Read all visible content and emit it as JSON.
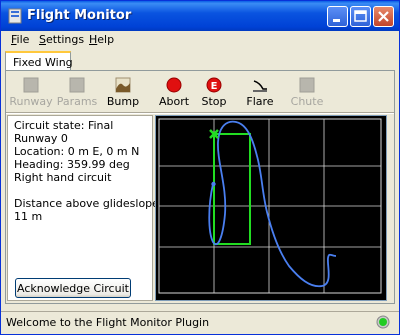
{
  "window": {
    "title": "Flight Monitor"
  },
  "titlebar": {
    "minimize_icon": "minimize-icon",
    "maximize_icon": "maximize-icon",
    "close_icon": "close-icon"
  },
  "menu": {
    "items": [
      {
        "label": "File",
        "accel": "F"
      },
      {
        "label": "Settings",
        "accel": "S"
      },
      {
        "label": "Help",
        "accel": "H"
      }
    ]
  },
  "tabs": [
    {
      "label": "Fixed Wing",
      "selected": true
    }
  ],
  "toolbar": {
    "buttons": [
      {
        "label": "Runway",
        "icon": "runway-icon",
        "enabled": false
      },
      {
        "label": "Params",
        "icon": "params-icon",
        "enabled": false
      },
      {
        "label": "Bump",
        "icon": "bump-icon",
        "enabled": true
      },
      {
        "label": "Abort",
        "icon": "abort-icon",
        "enabled": true
      },
      {
        "label": "Stop",
        "icon": "stop-icon",
        "enabled": true
      },
      {
        "label": "Flare",
        "icon": "flare-icon",
        "enabled": true
      },
      {
        "label": "Chute",
        "icon": "chute-icon",
        "enabled": false
      }
    ]
  },
  "info": {
    "circuit_state": "Circuit state: Final",
    "runway": "Runway 0",
    "location": "Location: 0 m E, 0 m N",
    "heading": "Heading: 359.99 deg",
    "circuit_side": "Right hand circuit",
    "glideslope_label": "Distance above glideslope:",
    "glideslope_value": "11 m",
    "acknowledge_button": "Acknowledge Circuit"
  },
  "map": {
    "colors": {
      "background": "#000000",
      "grid": "#d8d8d8",
      "circuit": "#22dd22",
      "track": "#4a7ff0",
      "marker": "#22dd22"
    }
  },
  "status": {
    "text": "Welcome to the Flight Monitor Plugin",
    "led_color": "#22cc22"
  }
}
